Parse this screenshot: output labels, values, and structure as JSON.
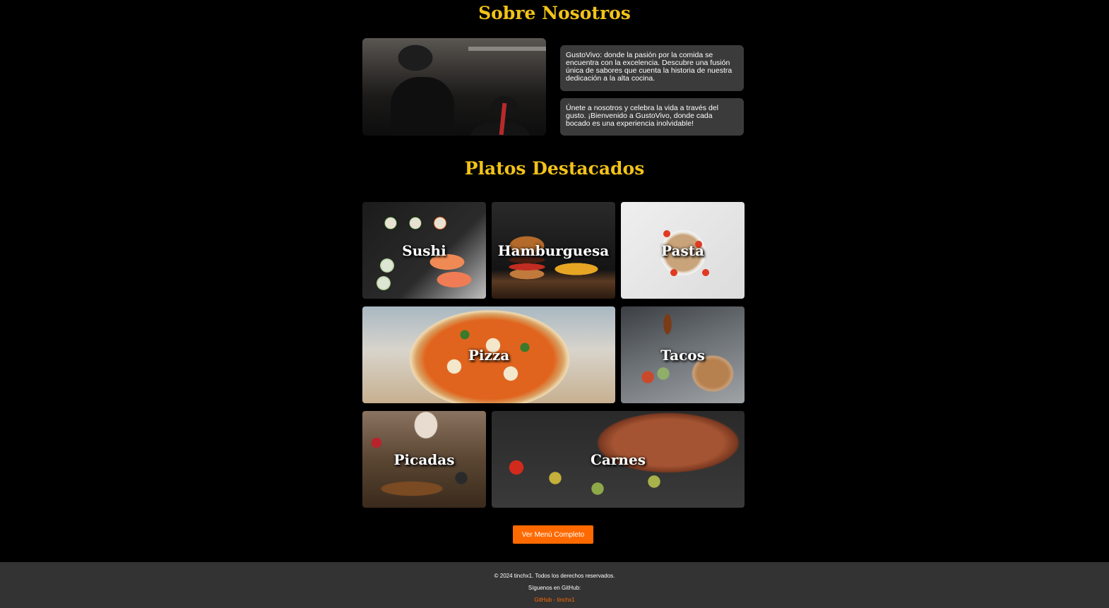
{
  "about": {
    "title": "Sobre Nosotros",
    "paragraph_1": "GustoVivo: donde la pasión por la comida se encuentra con la excelencia. Descubre una fusión única de sabores que cuenta la historia de nuestra dedicación a la alta cocina.",
    "paragraph_2": "Únete a nosotros y celebra la vida a través del gusto. ¡Bienvenido a GustoVivo, donde cada bocado es una experiencia inolvidable!"
  },
  "dishes": {
    "title": "Platos Destacados",
    "items": [
      {
        "label": "Sushi"
      },
      {
        "label": "Hamburguesa"
      },
      {
        "label": "Pasta"
      },
      {
        "label": "Pizza"
      },
      {
        "label": "Tacos"
      },
      {
        "label": "Picadas"
      },
      {
        "label": "Carnes"
      }
    ]
  },
  "cta": {
    "label": "Ver Menú Completo"
  },
  "footer": {
    "copyright": "© 2024 tinchx1. Todos los derechos reservados.",
    "follow": "Síguenos en GitHub:",
    "github_link": "GitHub - tinchx1"
  },
  "colors": {
    "accent": "#ff6a00",
    "title": "#f2c318",
    "card": "#3b3b3b",
    "footer_bg": "#333333"
  }
}
